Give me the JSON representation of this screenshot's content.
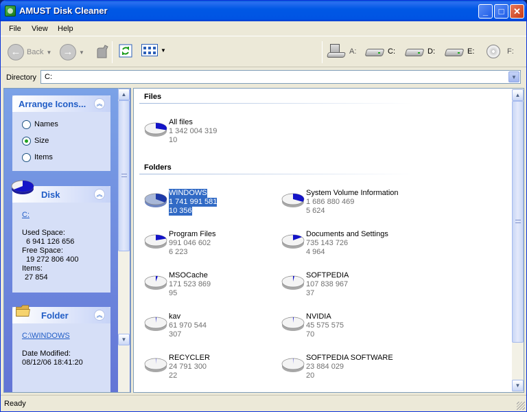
{
  "window": {
    "title": "AMUST Disk Cleaner"
  },
  "menu": [
    "File",
    "View",
    "Help"
  ],
  "toolbar": {
    "back_label": "Back",
    "drives": [
      {
        "label": "A:",
        "icon": "floppy-drive-icon"
      },
      {
        "label": "C:",
        "icon": "hard-drive-icon"
      },
      {
        "label": "D:",
        "icon": "hard-drive-icon"
      },
      {
        "label": "E:",
        "icon": "hard-drive-icon"
      },
      {
        "label": "F:",
        "icon": "cd-drive-icon"
      }
    ]
  },
  "directory": {
    "label": "Directory",
    "value": "C:"
  },
  "arrange": {
    "title": "Arrange Icons...",
    "options": [
      "Names",
      "Size",
      "Items"
    ],
    "selected": "Size"
  },
  "disk": {
    "title": "Disk",
    "link": "C:",
    "used_label": "Used Space:",
    "used_value": "6 941 126 656",
    "free_label": "Free Space:",
    "free_value": "19 272 806 400",
    "items_label": "Items:",
    "items_value": "27 854"
  },
  "folder": {
    "title": "Folder",
    "link": "C:\\WINDOWS",
    "date_label": "Date Modified:",
    "date_value": "08/12/06 18:41:20"
  },
  "files_section": {
    "heading": "Files",
    "items": [
      {
        "name": "All files",
        "size": "1 342 004 319",
        "count": "10",
        "fraction": 0.3
      }
    ]
  },
  "folders_section": {
    "heading": "Folders",
    "items": [
      {
        "name": "WINDOWS",
        "size": "1 741 991 581",
        "count": "10 356",
        "fraction": 0.35,
        "selected": true
      },
      {
        "name": "System Volume Information",
        "size": "1 686 880 469",
        "count": "5 624",
        "fraction": 0.33
      },
      {
        "name": "Program Files",
        "size": "991 046 602",
        "count": "6 223",
        "fraction": 0.2
      },
      {
        "name": "Documents and Settings",
        "size": "735 143 726",
        "count": "4 964",
        "fraction": 0.15
      },
      {
        "name": "MSOCache",
        "size": "171 523 869",
        "count": "95",
        "fraction": 0.03
      },
      {
        "name": "SOFTPEDIA",
        "size": "107 838 967",
        "count": "37",
        "fraction": 0.02
      },
      {
        "name": "kav",
        "size": "61 970 544",
        "count": "307",
        "fraction": 0.01
      },
      {
        "name": "NVIDIA",
        "size": "45 575 575",
        "count": "70",
        "fraction": 0.01
      },
      {
        "name": "RECYCLER",
        "size": "24 791 300",
        "count": "22",
        "fraction": 0.005
      },
      {
        "name": "SOFTPEDIA SOFTWARE",
        "size": "23 884 029",
        "count": "20",
        "fraction": 0.005
      }
    ]
  },
  "status": {
    "text": "Ready"
  }
}
